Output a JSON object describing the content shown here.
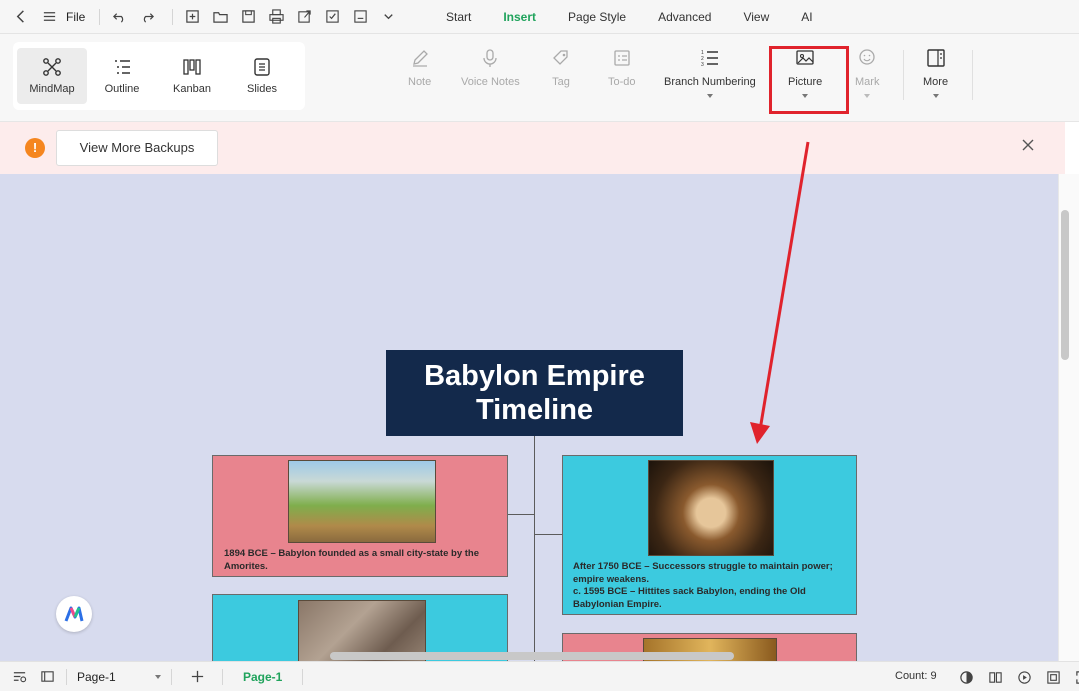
{
  "topbar": {
    "file_label": "File",
    "tabs": [
      "Start",
      "Insert",
      "Page Style",
      "Advanced",
      "View",
      "AI"
    ],
    "active_tab": "Insert"
  },
  "ribbon": {
    "views": [
      "MindMap",
      "Outline",
      "Kanban",
      "Slides"
    ],
    "active_view": "MindMap",
    "tools": {
      "note": "Note",
      "voice_notes": "Voice Notes",
      "tag": "Tag",
      "todo": "To-do",
      "branch_numbering": "Branch Numbering",
      "picture": "Picture",
      "mark": "Mark",
      "more": "More"
    },
    "highlight_color": "#e0232c"
  },
  "notice": {
    "button_label": "View More Backups",
    "icon_glyph": "!"
  },
  "mindmap": {
    "central_topic": "Babylon Empire Timeline",
    "central_color": "#13294b",
    "branches": [
      {
        "text": "1894 BCE – Babylon founded as a small city-state by the Amorites.",
        "color": "#e8848e"
      },
      {
        "text": "After 1750 BCE – Successors struggle to maintain power; empire weakens.\nc. 1595 BCE – Hittites sack Babylon, ending the Old Babylonian Empire.",
        "color": "#3ccadf"
      }
    ],
    "canvas_color": "#d7dbee"
  },
  "statusbar": {
    "page_select": "Page-1",
    "page_tab": "Page-1",
    "count": "Count: 9"
  }
}
